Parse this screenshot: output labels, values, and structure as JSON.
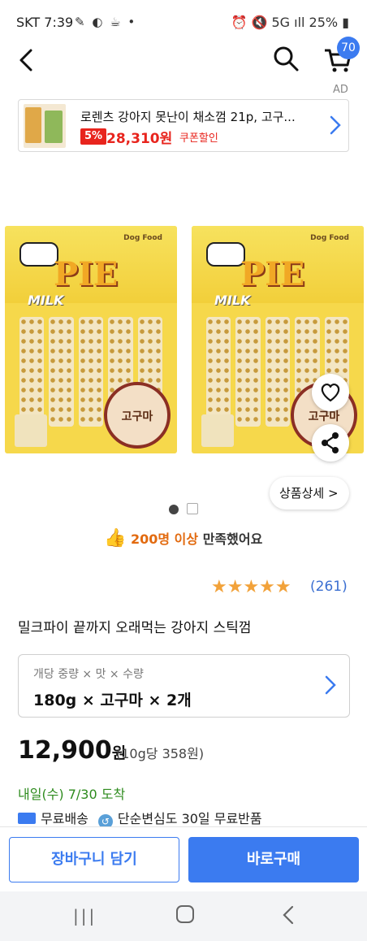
{
  "status_bar": {
    "carrier_time": "SKT 7:39",
    "battery": "25%",
    "left_icons": [
      "pill-icon",
      "moon-icon",
      "bowl-icon",
      "dot-icon"
    ],
    "right_icons": [
      "alarm-icon",
      "mute-icon",
      "5g-icon",
      "signal-icon",
      "battery-icon"
    ]
  },
  "header": {
    "cart_count": "70",
    "ad_label": "AD"
  },
  "ad": {
    "title": "로렌츠 강아지 못난이 채소껌 21p, 고구...",
    "discount": "5%",
    "price": "28,310원",
    "coupon": "쿠폰할인"
  },
  "product_images": {
    "brand": "Dog Food",
    "pie": "PIE",
    "milk": "MILK",
    "seal_text": "고구마"
  },
  "detail_button": "상품상세 >",
  "satisfaction": {
    "highlight": "200명 이상",
    "suffix": " 만족했어요"
  },
  "rating": {
    "stars": "★★★★★",
    "count": "(261)"
  },
  "product_name": "밀크파이 끝까지 오래먹는 강아지 스틱껌",
  "option": {
    "label": "개당 중량 × 맛 × 수량",
    "value": "180g × 고구마 × 2개"
  },
  "price": {
    "amount": "12,900",
    "won": "원",
    "unit_price": "(10g당 358원)"
  },
  "arrival": "내일(수) 7/30 도착",
  "shipping": {
    "free": "무료배송",
    "return": "단순변심도 30일 무료반품"
  },
  "actions": {
    "cart": "장바구니 담기",
    "buy": "바로구매"
  },
  "colors": {
    "accent": "#3b7bf0",
    "sale": "#e8241d",
    "arrival": "#2e8b1e",
    "star": "#f2a23a"
  }
}
